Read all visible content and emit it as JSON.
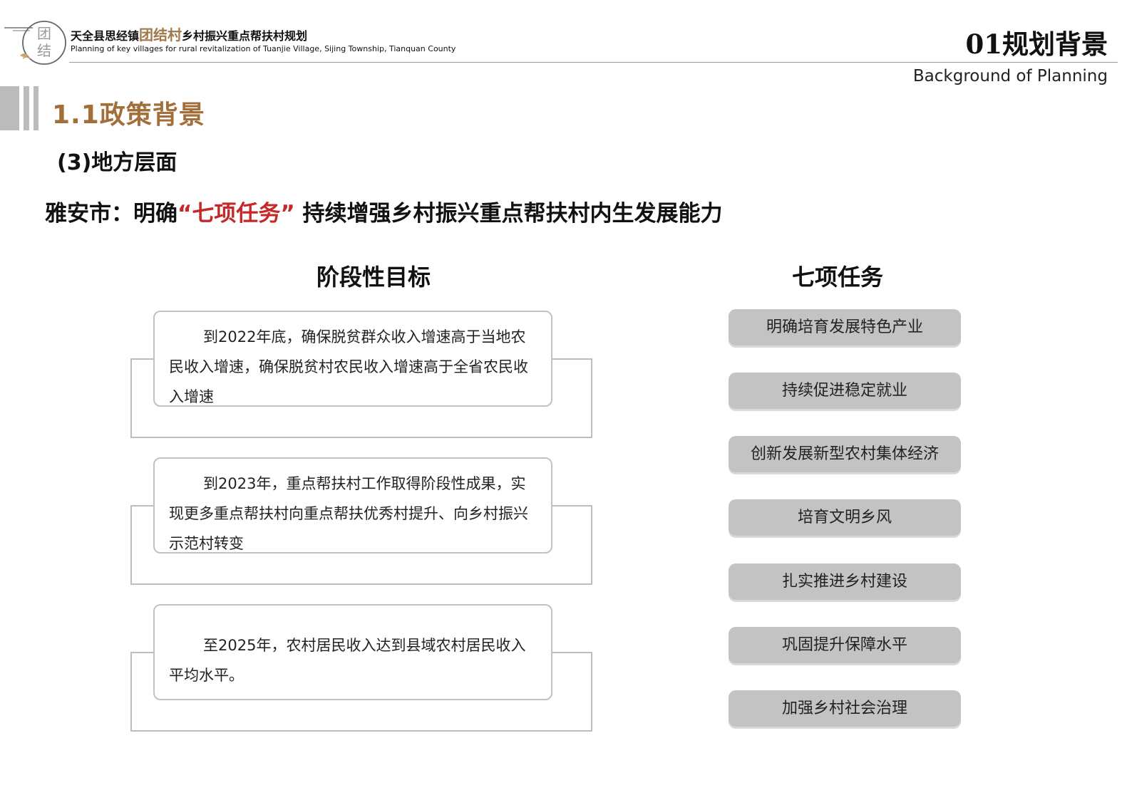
{
  "header": {
    "logo_text": "团结",
    "title_prefix": "天全县思经镇",
    "title_brand": "团结村",
    "title_suffix": "乡村振兴重点帮扶村规划",
    "subtitle_en": "Planning of key villages for rural revitalization of Tuanjie Village, Sijing Township, Tianquan County",
    "section_number_title": "01规划背景",
    "section_en": "Background of Planning"
  },
  "section": {
    "title": "1.1政策背景",
    "subtitle": "(3)地方层面"
  },
  "headline": {
    "prefix": "雅安市：明确",
    "highlight": "“七项任务”",
    "suffix": " 持续增强乡村振兴重点帮扶村内生发展能力"
  },
  "goals": {
    "title": "阶段性目标",
    "items": [
      "到2022年底，确保脱贫群众收入增速高于当地农民收入增速，确保脱贫村农民收入增速高于全省农民收入增速",
      "到2023年，重点帮扶村工作取得阶段性成果，实现更多重点帮扶村向重点帮扶优秀村提升、向乡村振兴示范村转变",
      "至2025年，农村居民收入达到县域农村居民收入平均水平。"
    ]
  },
  "tasks": {
    "title": "七项任务",
    "items": [
      "明确培育发展特色产业",
      "持续促进稳定就业",
      "创新发展新型农村集体经济",
      "培育文明乡风",
      "扎实推进乡村建设",
      "巩固提升保障水平",
      "加强乡村社会治理"
    ]
  },
  "colors": {
    "brand": "#a0784c",
    "section_title": "#a26f3b",
    "highlight_red": "#c62828",
    "task_bg": "#c3c3c3"
  }
}
